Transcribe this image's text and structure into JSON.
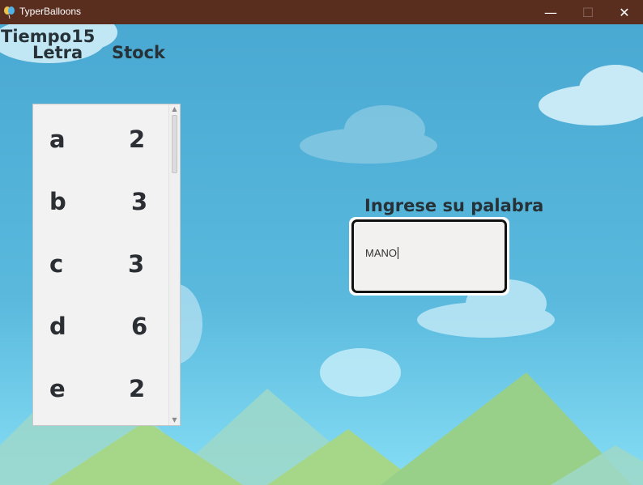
{
  "window": {
    "title": "TyperBalloons",
    "controls": {
      "minimize": "—",
      "maximize": "☐",
      "close": "✕"
    }
  },
  "labels": {
    "tiempo": "Tiempo15",
    "letra": "Letra",
    "stock": "Stock",
    "prompt": "Ingrese su palabra"
  },
  "letters": [
    {
      "letter": "a",
      "stock": "2"
    },
    {
      "letter": "b",
      "stock": "3"
    },
    {
      "letter": "c",
      "stock": "3"
    },
    {
      "letter": "d",
      "stock": "6"
    },
    {
      "letter": "e",
      "stock": "2"
    }
  ],
  "input": {
    "value": "MANO"
  },
  "colors": {
    "titlebar": "#5a2e1f",
    "sky_top": "#4aa9d2",
    "sky_bottom": "#86def5",
    "mountain": "#98d08a",
    "label_text": "#263238"
  },
  "icons": {
    "app": "balloon-icon"
  }
}
